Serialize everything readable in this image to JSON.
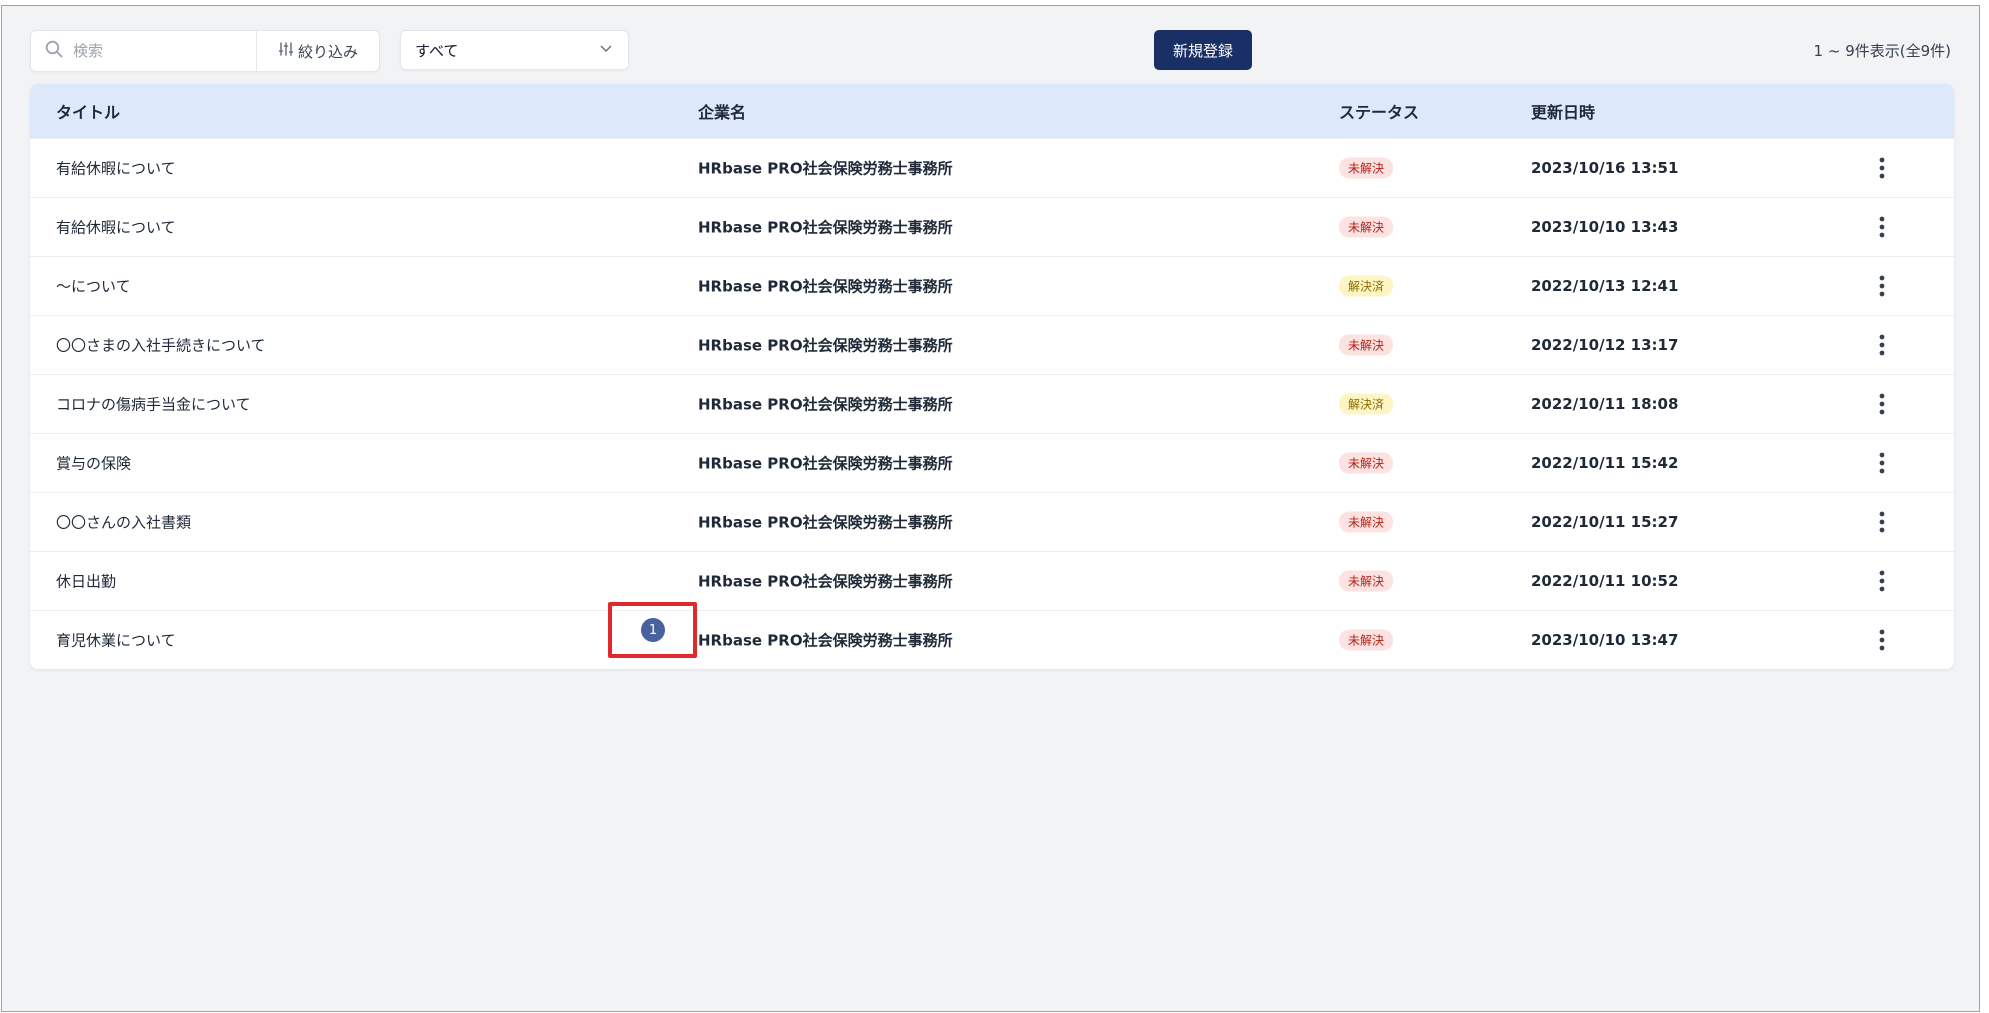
{
  "toolbar": {
    "search_placeholder": "検索",
    "filter_label": "絞り込み",
    "select_value": "すべて",
    "new_button": "新規登録",
    "count_text": "1 ~ 9件表示(全9件)"
  },
  "table": {
    "headers": {
      "title": "タイトル",
      "company": "企業名",
      "status": "ステータス",
      "updated": "更新日時"
    },
    "rows": [
      {
        "title": "有給休暇について",
        "company": "HRbase PRO社会保険労務士事務所",
        "status": "未解決",
        "updated": "2023/10/16 13:51"
      },
      {
        "title": "有給休暇について",
        "company": "HRbase PRO社会保険労務士事務所",
        "status": "未解決",
        "updated": "2023/10/10 13:43"
      },
      {
        "title": "〜について",
        "company": "HRbase PRO社会保険労務士事務所",
        "status": "解決済",
        "updated": "2022/10/13 12:41"
      },
      {
        "title": "〇〇さまの入社手続きについて",
        "company": "HRbase PRO社会保険労務士事務所",
        "status": "未解決",
        "updated": "2022/10/12 13:17"
      },
      {
        "title": "コロナの傷病手当金について",
        "company": "HRbase PRO社会保険労務士事務所",
        "status": "解決済",
        "updated": "2022/10/11 18:08"
      },
      {
        "title": "賞与の保険",
        "company": "HRbase PRO社会保険労務士事務所",
        "status": "未解決",
        "updated": "2022/10/11 15:42"
      },
      {
        "title": "〇〇さんの入社書類",
        "company": "HRbase PRO社会保険労務士事務所",
        "status": "未解決",
        "updated": "2022/10/11 15:27"
      },
      {
        "title": "休日出勤",
        "company": "HRbase PRO社会保険労務士事務所",
        "status": "未解決",
        "updated": "2022/10/11 10:52"
      },
      {
        "title": "育児休業について",
        "company": "HRbase PRO社会保険労務士事務所",
        "status": "未解決",
        "updated": "2023/10/10 13:47"
      }
    ]
  },
  "annotation": {
    "number": "1",
    "color": "#e0292a",
    "badge_color": "#47629e"
  },
  "colors": {
    "primary": "#1a2f66",
    "header_bg": "#dde9fb",
    "unresolved_bg": "#fde2e2",
    "unresolved_text": "#b42318",
    "resolved_bg": "#fdf5c4",
    "resolved_text": "#8a6d00"
  },
  "icons": {
    "search": "search-icon",
    "filter": "sliders-icon",
    "select": "chevron-down-icon",
    "row_menu": "kebab-menu-icon"
  }
}
